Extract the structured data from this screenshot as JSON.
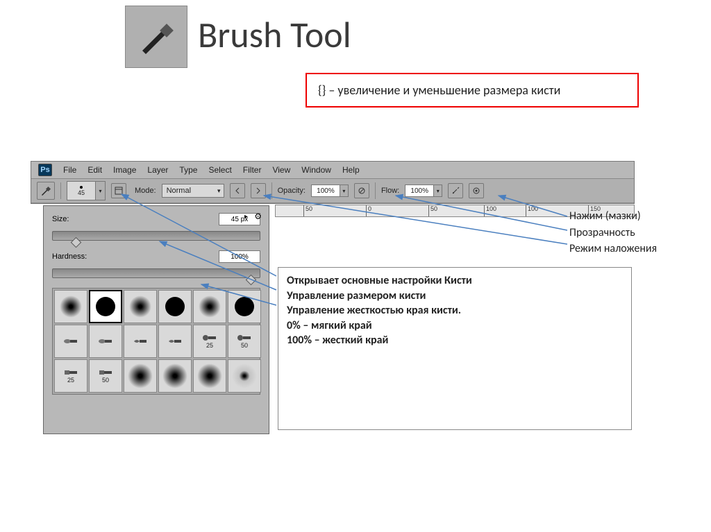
{
  "title": "Brush Tool",
  "red_box": "{} – увеличение и уменьшение размера кисти",
  "menu": {
    "app": "Ps",
    "items": [
      "File",
      "Edit",
      "Image",
      "Layer",
      "Type",
      "Select",
      "Filter",
      "View",
      "Window",
      "Help"
    ]
  },
  "options_bar": {
    "brush_size_preview": "45",
    "mode_label": "Mode:",
    "mode_value": "Normal",
    "opacity_label": "Opacity:",
    "opacity_value": "100%",
    "flow_label": "Flow:",
    "flow_value": "100%"
  },
  "brush_flyout": {
    "size_label": "Size:",
    "size_value": "45 px",
    "hardness_label": "Hardness:",
    "hardness_value": "100%",
    "preset_labels": [
      "",
      "",
      "",
      "",
      "",
      "",
      "",
      "",
      "",
      "",
      "25",
      "50",
      "25",
      "50",
      "",
      "",
      "",
      "",
      ""
    ]
  },
  "ruler_ticks": [
    "50",
    "0",
    "50",
    "100",
    "100",
    "150"
  ],
  "callouts_right": [
    "Нажим (мазки)",
    "Прозрачность",
    "Режим наложения"
  ],
  "callouts_center": [
    "Открывает основные настройки Кисти",
    "Управление размером кисти",
    "Управление жесткостью края кисти.",
    "0% – мягкий край",
    "100% – жесткий край"
  ]
}
